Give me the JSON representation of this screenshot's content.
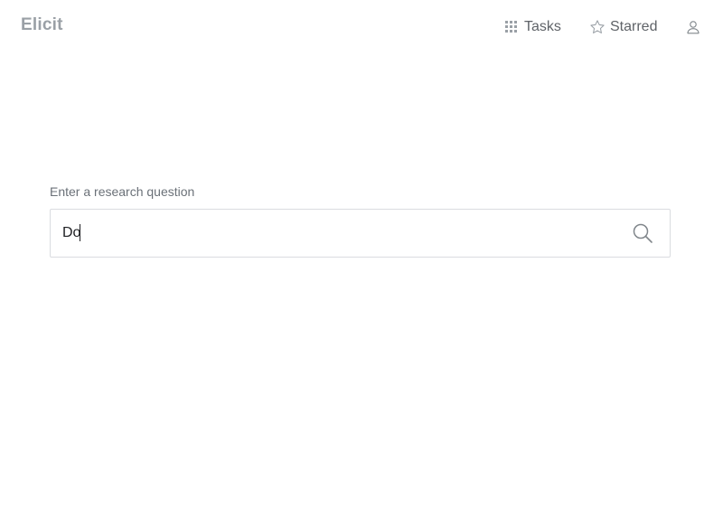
{
  "app": {
    "title": "Elicit"
  },
  "nav": {
    "tasks_label": "Tasks",
    "starred_label": "Starred",
    "tasks_icon": "grid-icon",
    "starred_icon": "star-icon",
    "user_icon": "user-icon"
  },
  "search": {
    "label": "Enter a research question",
    "value": "Do",
    "icon": "search-icon"
  },
  "colors": {
    "logo": "#9aa0a6",
    "nav_text": "#5f6368",
    "border": "#dadce0",
    "label": "#6b7178"
  }
}
